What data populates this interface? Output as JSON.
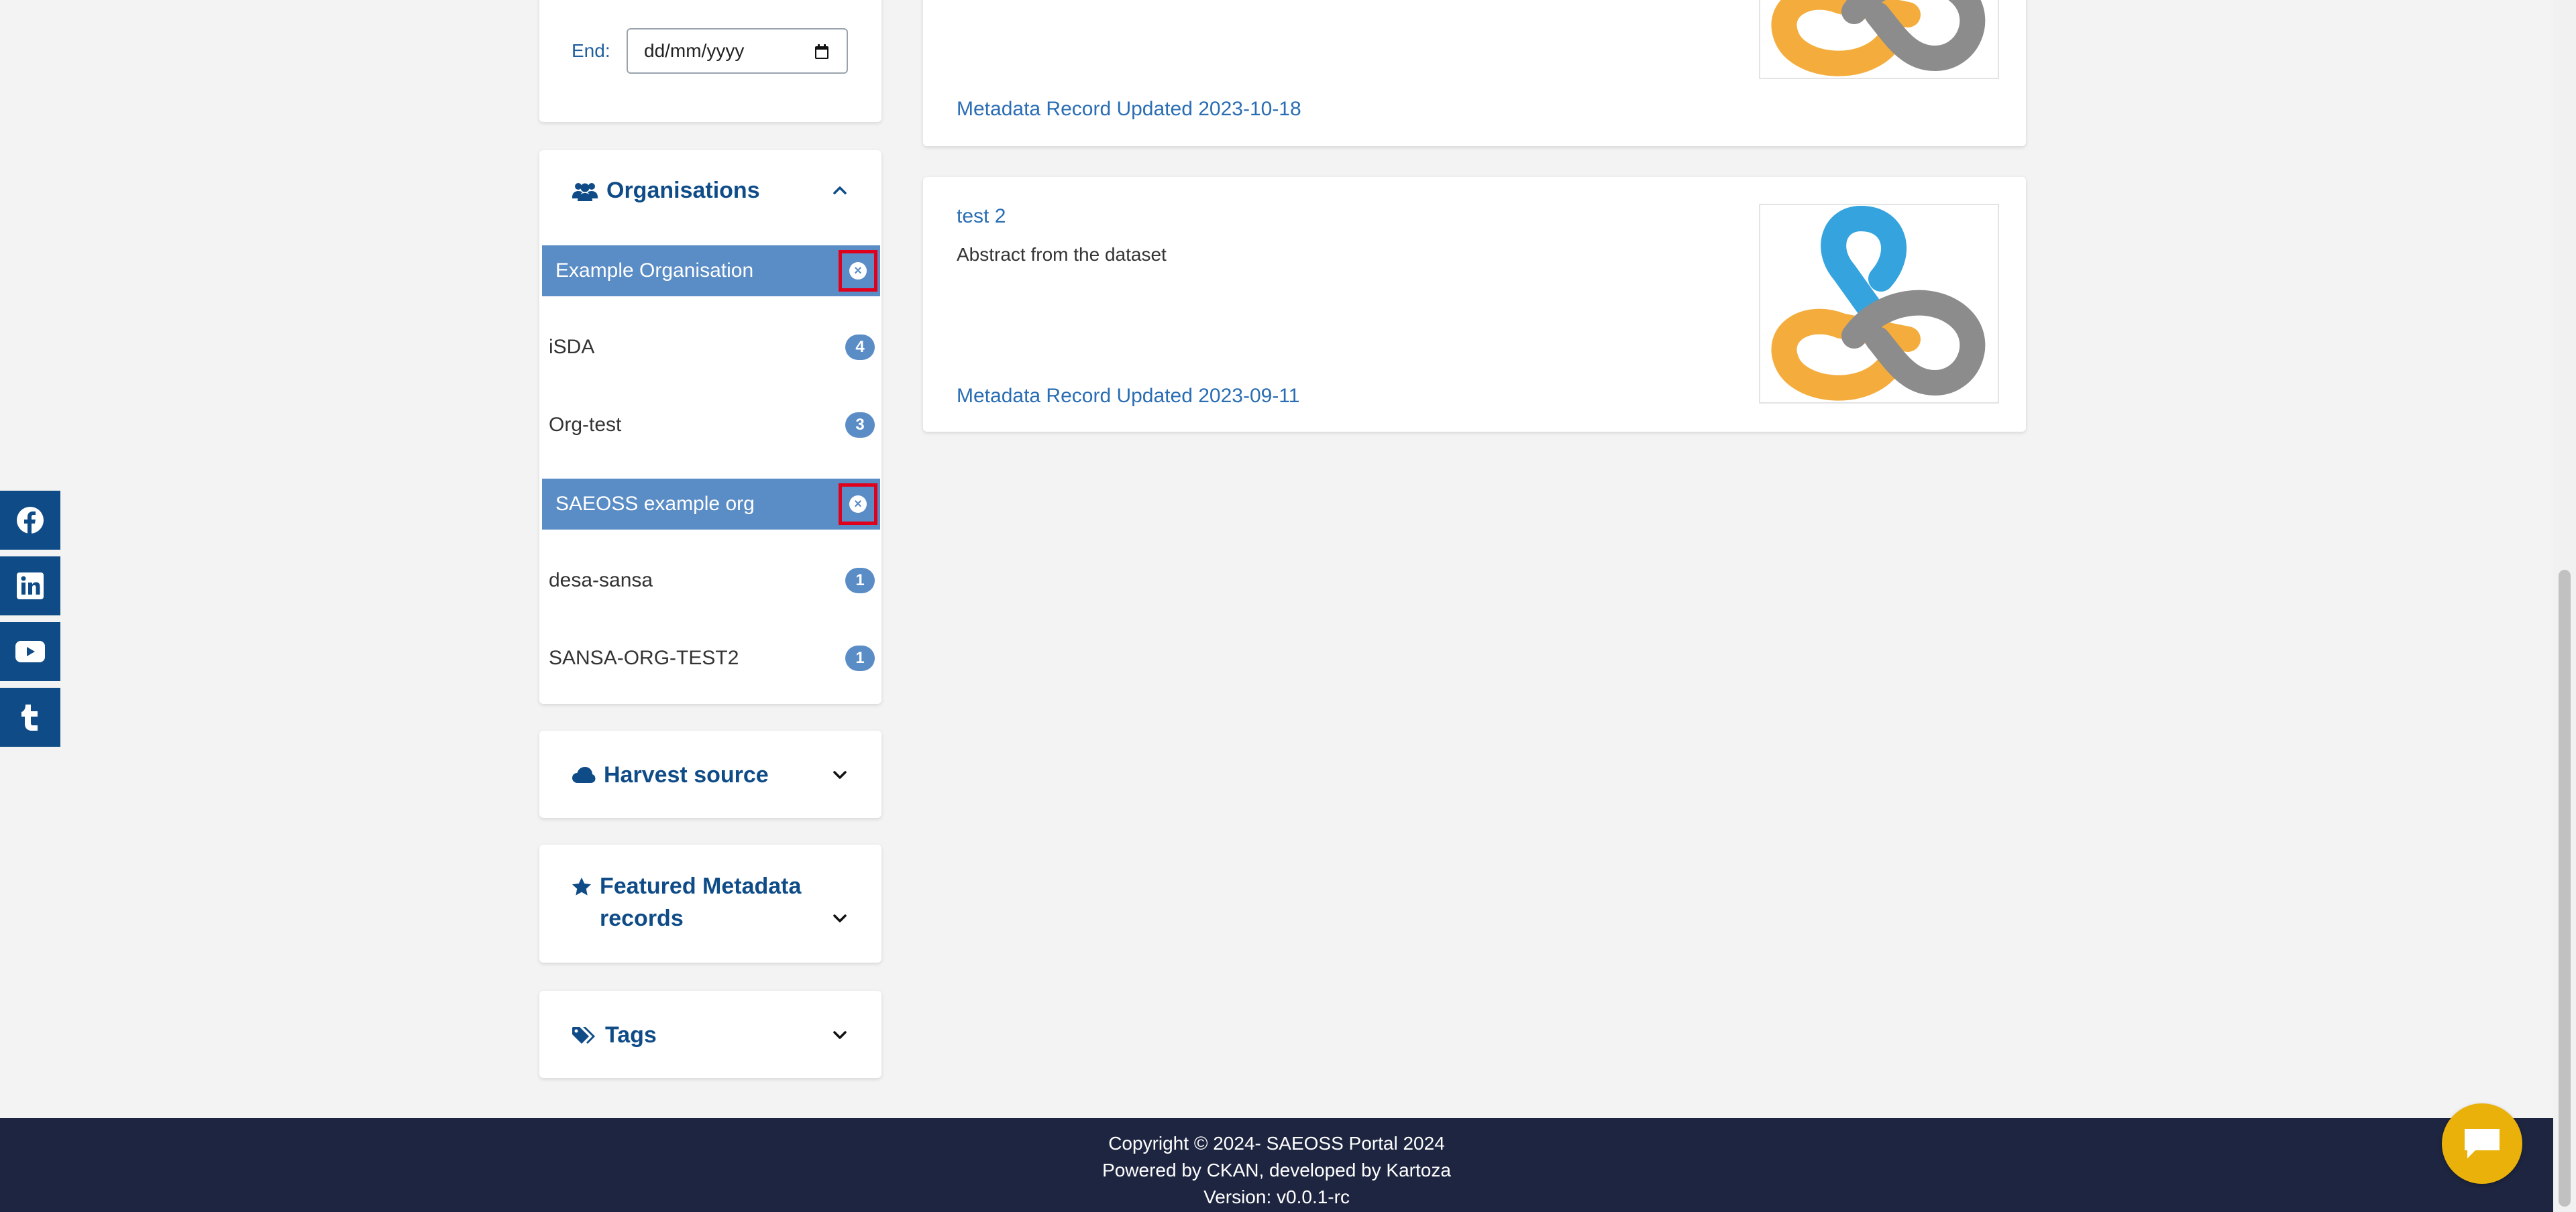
{
  "date_filter": {
    "end_label": "End:",
    "end_placeholder": "dd/mm/yyyy"
  },
  "organisations": {
    "title": "Organisations",
    "items": [
      {
        "name": "Example Organisation",
        "active": true,
        "count": ""
      },
      {
        "name": "iSDA",
        "active": false,
        "count": "4"
      },
      {
        "name": "Org-test",
        "active": false,
        "count": "3"
      },
      {
        "name": "SAEOSS example org",
        "active": true,
        "count": ""
      },
      {
        "name": "desa-sansa",
        "active": false,
        "count": "1"
      },
      {
        "name": "SANSA-ORG-TEST2",
        "active": false,
        "count": "1"
      }
    ]
  },
  "harvest_source": {
    "title": "Harvest source"
  },
  "featured": {
    "title": "Featured Metadata records"
  },
  "tags": {
    "title": "Tags"
  },
  "results": [
    {
      "title": "",
      "abstract": "",
      "updated": "Metadata Record Updated 2023-10-18"
    },
    {
      "title": "test 2",
      "abstract": "Abstract from the dataset",
      "updated": "Metadata Record Updated 2023-09-11"
    }
  ],
  "social": [
    "facebook-icon",
    "linkedin-icon",
    "youtube-icon",
    "tumblr-icon"
  ],
  "footer": {
    "copyright": "Copyright © 2024- SAEOSS Portal 2024",
    "powered": "Powered by CKAN, developed by Kartoza",
    "version": "Version: v0.0.1-rc"
  },
  "colors": {
    "primary": "#0f4c87",
    "active_facet": "#5a8cc6",
    "link": "#2a6db3",
    "footer": "#1e2540",
    "chat": "#e9b10a",
    "highlight": "#e0001b"
  }
}
